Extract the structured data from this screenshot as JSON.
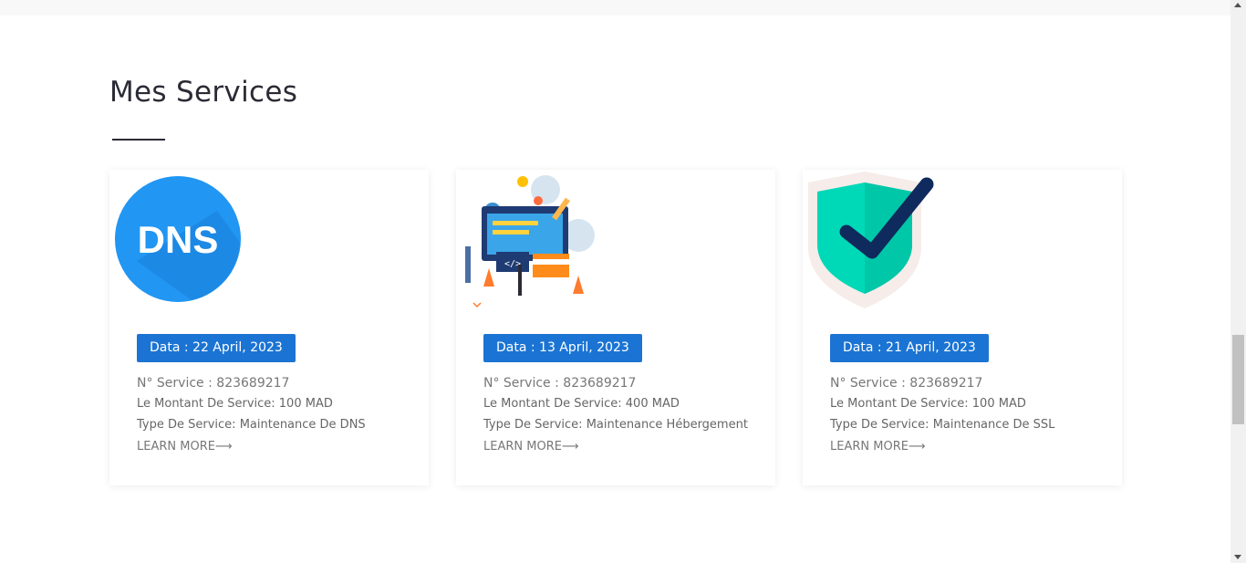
{
  "section": {
    "title": "Mes Services"
  },
  "services": [
    {
      "icon": "dns-icon",
      "icon_text": "DNS",
      "date": "Data : 22 April, 2023",
      "number": "N° Service : 823689217",
      "amount": "Le Montant De Service: 100 MAD",
      "type": "Type De Service: Maintenance De DNS",
      "learn_more": "LEARN MORE⟶"
    },
    {
      "icon": "web-construction-illustration",
      "date": "Data : 13 April, 2023",
      "number": "N° Service : 823689217",
      "amount": "Le Montant De Service: 400 MAD",
      "type": "Type De Service: Maintenance Hébergement",
      "learn_more": "LEARN MORE⟶"
    },
    {
      "icon": "ssl-shield-check-icon",
      "date": "Data : 21 April, 2023",
      "number": "N° Service : 823689217",
      "amount": "Le Montant De Service: 100 MAD",
      "type": "Type De Service: Maintenance De SSL",
      "learn_more": "LEARN MORE⟶"
    }
  ],
  "colors": {
    "badge": "#1b74d3",
    "title": "#2b2b36",
    "dns_blue": "#2196f3",
    "shield_teal": "#00d9b8",
    "check_navy": "#0f2a5c"
  }
}
